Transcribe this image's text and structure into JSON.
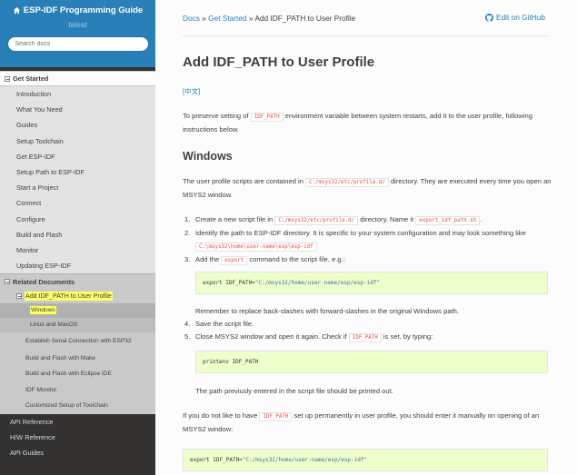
{
  "sidebar": {
    "title": "ESP-IDF Programming Guide",
    "version": "latest",
    "search_placeholder": "Search docs",
    "get_started": "Get Started",
    "items": [
      "Introduction",
      "What You Need",
      "Guides",
      "Setup Toolchain",
      "Get ESP-IDF",
      "Setup Path to ESP-IDF",
      "Start a Project",
      "Connect",
      "Configure",
      "Build and Flash",
      "Monitor",
      "Updating ESP-IDF"
    ],
    "related": "Related Documents",
    "current_page": "Add IDF_PATH to User Profile",
    "sub_windows": "Windows",
    "sub_linux": "Linux and MacOS",
    "related_items": [
      "Establish Serial Connection with ESP32",
      "Build and Flash with Make",
      "Build and Flash with Eclipse IDE",
      "IDF Monitor",
      "Customized Setup of Toolchain"
    ],
    "top_items": [
      "API Reference",
      "H/W Reference",
      "API Guides"
    ]
  },
  "breadcrumb": {
    "docs": "Docs",
    "sep": "»",
    "get_started": "Get Started",
    "current": "Add IDF_PATH to User Profile"
  },
  "github_link": "Edit on GitHub",
  "page": {
    "title": "Add IDF_PATH to User Profile",
    "lang_link": "[中文]",
    "intro_a": "To preserve setting of ",
    "intro_code": "IDF_PATH",
    "intro_b": " environment variable between system restarts, add it to the user profile, following instructions below.",
    "windows_heading": "Windows",
    "win_p_a": "The user profile scripts are contained in ",
    "win_p_code": "C:/msys32/etc/profile.d/",
    "win_p_b": " directory. They are executed every time you open an MSYS2 window.",
    "step1_a": "Create a new script file in ",
    "step1_code1": "C:/msys32/etc/profile.d/",
    "step1_b": " directory. Name it ",
    "step1_code2": "export_idf_path.sh",
    "step1_c": ".",
    "step2_a": "Identify the path to ESP-IDF directory. It is specific to your system configuration and may look something like ",
    "step2_code": "C:\\msys32\\home\\user-name\\esp\\esp-idf",
    "step3_a": "Add the ",
    "step3_code": "export",
    "step3_b": " command to the script file, e.g.:",
    "code1_a": "export IDF_PATH=",
    "code1_b": "\"C:/msys32/home/user-name/esp/esp-idf\"",
    "remember": "Remember to replace back-slashes with forward-slashes in the original Windows path.",
    "step4": "Save the script file.",
    "step5_a": "Close MSYS2 window and open it again. Check if ",
    "step5_code": "IDF_PATH",
    "step5_b": " is set, by typing:",
    "code2": "printenv IDF_PATH",
    "printed_out": "The path previusly entered in the script file should be printed out.",
    "manual_a": "If you do not like to have ",
    "manual_code": "IDF_PATH",
    "manual_b": " set up permanently in user profile, you should enter it manually on opening of an MSYS2 window:",
    "code3_a": "export IDF_PATH=",
    "code3_b": "\"C:/msys32/home/user-name/esp/esp-idf\"",
    "nums": [
      "1.",
      "2.",
      "3.",
      "4.",
      "5."
    ]
  },
  "colors": {
    "link": "#2980b9",
    "sidebar_top": "#2980b9",
    "sidebar_bg": "#343131",
    "code_red": "#e74c3c",
    "code_bg": "#eeffcc",
    "highlight": "#ffff66"
  }
}
